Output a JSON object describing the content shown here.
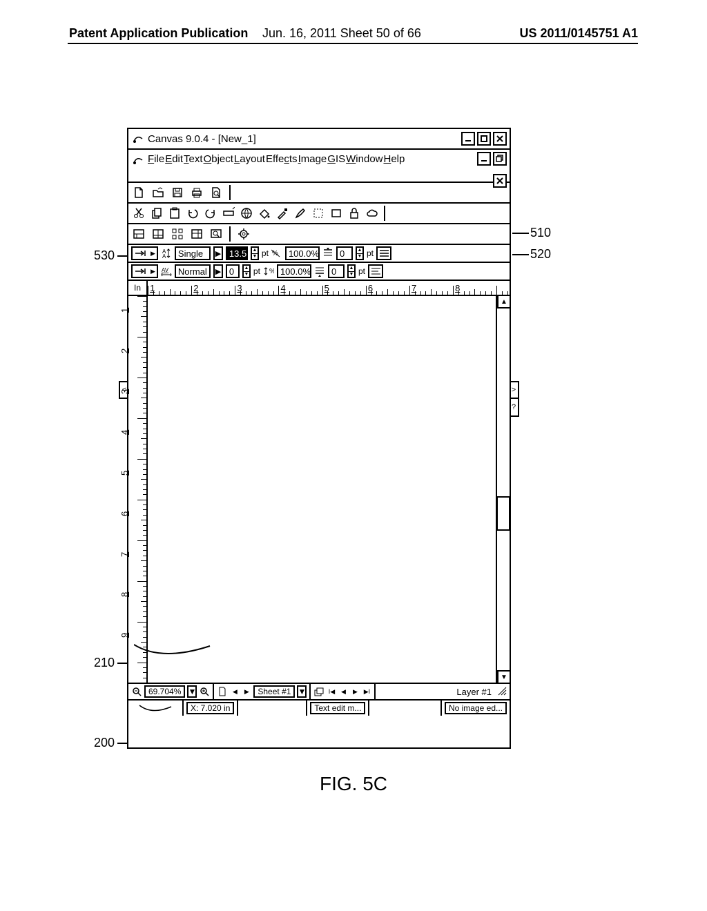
{
  "pub": {
    "left": "Patent Application Publication",
    "mid": "Jun. 16, 2011  Sheet 50 of 66",
    "right": "US 2011/0145751 A1"
  },
  "app": {
    "title": "Canvas 9.0.4 - [New_1]"
  },
  "menu": {
    "file": "File",
    "edit": "Edit",
    "text": "Text",
    "object": "Object",
    "layout": "Layout",
    "effects": "Effects",
    "image": "Image",
    "gis": "GIS",
    "window": "Window",
    "help": "Help"
  },
  "param": {
    "r1": {
      "spacing": "Single",
      "size": "13.5",
      "pt1": "pt",
      "pct_icon": "%",
      "pct": "100.0%",
      "indent": "0",
      "pt2": "pt"
    },
    "r2": {
      "kerning": "Normal",
      "track": "0",
      "pt1": "pt",
      "pct_icon": "%",
      "pct": "100.0%",
      "indent": "0",
      "pt2": "pt"
    }
  },
  "ruler": {
    "unit": "In",
    "h": [
      "1",
      "2",
      "3",
      "4",
      "5",
      "6",
      "7",
      "8"
    ],
    "v": [
      "1",
      "2",
      "3",
      "4",
      "5",
      "6",
      "7",
      "8",
      "9"
    ]
  },
  "status": {
    "zoom": "69.704%",
    "sheet": "Sheet #1",
    "layer": "Layer #1",
    "x": "X: 7.020 in",
    "mode": "Text edit m...",
    "img": "No image ed..."
  },
  "callouts": {
    "c530": "530",
    "c510": "510",
    "c520": "520",
    "c210": "210",
    "c200": "200"
  },
  "sidechars": {
    "lt": "<",
    "gt": ">",
    "q": "?"
  },
  "figure": "FIG. 5C"
}
